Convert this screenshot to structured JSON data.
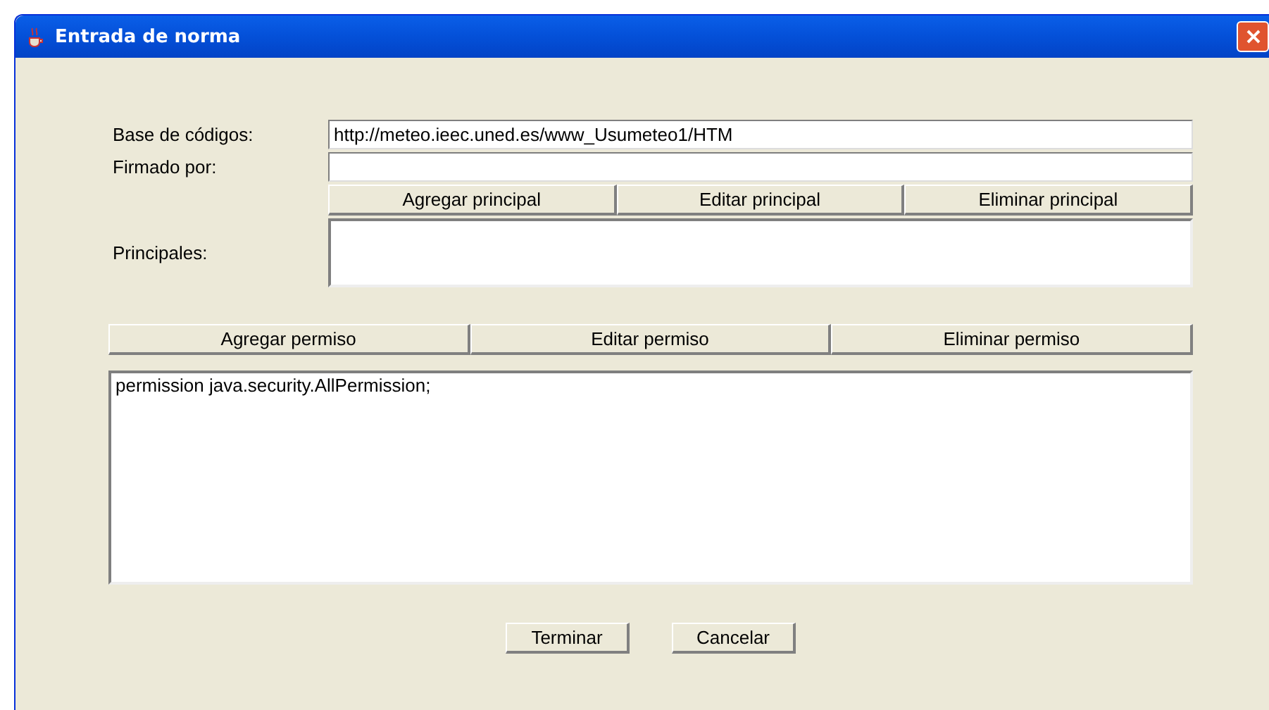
{
  "window": {
    "title": "Entrada de norma"
  },
  "fields": [
    {
      "label": "Base de códigos:",
      "value": "http://meteo.ieec.uned.es/www_Usumeteo1/HTM"
    },
    {
      "label": "Firmado por:"
    }
  ],
  "principal_buttons": [
    "Agregar principal",
    "Editar principal",
    "Eliminar principal"
  ],
  "principals": {
    "label": "Principales:"
  },
  "permission_buttons": [
    "Agregar permiso",
    "Editar permiso",
    "Eliminar permiso"
  ],
  "permissions": [
    "permission java.security.AllPermission;"
  ],
  "buttons": [
    "Terminar",
    "Cancelar"
  ]
}
